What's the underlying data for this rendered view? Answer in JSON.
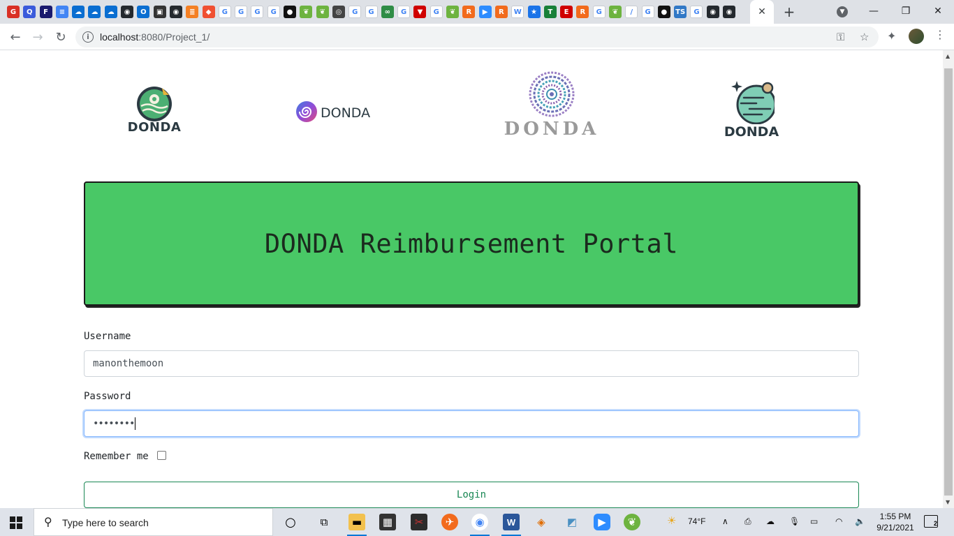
{
  "browser": {
    "tab_close_glyph": "✕",
    "new_tab_glyph": "+",
    "url_host": "localhost",
    "url_path": ":8080/Project_1/",
    "nav": {
      "back": "←",
      "forward": "→",
      "reload": "↻"
    },
    "window": {
      "minimize": "—",
      "restore": "❐",
      "close": "✕"
    },
    "tab_icons": [
      {
        "glyph": "G",
        "color": "#d93025"
      },
      {
        "glyph": "Q",
        "color": "#3b5bdb"
      },
      {
        "glyph": "F",
        "color": "#1a1a6e"
      },
      {
        "glyph": "≡",
        "color": "#4285f4"
      },
      {
        "glyph": "☁",
        "color": "#0a6ed1"
      },
      {
        "glyph": "☁",
        "color": "#0a6ed1"
      },
      {
        "glyph": "☁",
        "color": "#0a6ed1"
      },
      {
        "glyph": "◉",
        "color": "#24292e"
      },
      {
        "glyph": "O",
        "color": "#0a6ed1"
      },
      {
        "glyph": "▣",
        "color": "#333333"
      },
      {
        "glyph": "◉",
        "color": "#24292e"
      },
      {
        "glyph": "≣",
        "color": "#f48024"
      },
      {
        "glyph": "◆",
        "color": "#f05032"
      },
      {
        "glyph": "G",
        "color": "#ffffff"
      },
      {
        "glyph": "G",
        "color": "#ffffff"
      },
      {
        "glyph": "G",
        "color": "#ffffff"
      },
      {
        "glyph": "G",
        "color": "#ffffff"
      },
      {
        "glyph": "●",
        "color": "#111111"
      },
      {
        "glyph": "❦",
        "color": "#6db33f"
      },
      {
        "glyph": "❦",
        "color": "#6db33f"
      },
      {
        "glyph": "◎",
        "color": "#444444"
      },
      {
        "glyph": "G",
        "color": "#ffffff"
      },
      {
        "glyph": "G",
        "color": "#ffffff"
      },
      {
        "glyph": "∞",
        "color": "#2f8d46"
      },
      {
        "glyph": "G",
        "color": "#ffffff"
      },
      {
        "glyph": "▼",
        "color": "#d00000"
      },
      {
        "glyph": "G",
        "color": "#ffffff"
      },
      {
        "glyph": "❦",
        "color": "#6db33f"
      },
      {
        "glyph": "R",
        "color": "#f26b1d"
      },
      {
        "glyph": "▶",
        "color": "#2d8cff"
      },
      {
        "glyph": "R",
        "color": "#f26b1d"
      },
      {
        "glyph": "W",
        "color": "#ffffff"
      },
      {
        "glyph": "★",
        "color": "#1a73e8"
      },
      {
        "glyph": "T",
        "color": "#188038"
      },
      {
        "glyph": "E",
        "color": "#d00000"
      },
      {
        "glyph": "R",
        "color": "#f26b1d"
      },
      {
        "glyph": "G",
        "color": "#ffffff"
      },
      {
        "glyph": "❦",
        "color": "#6db33f"
      },
      {
        "glyph": "/",
        "color": "#ffffff"
      },
      {
        "glyph": "G",
        "color": "#ffffff"
      },
      {
        "glyph": "●",
        "color": "#111111"
      },
      {
        "glyph": "TS",
        "color": "#3178c6"
      },
      {
        "glyph": "G",
        "color": "#ffffff"
      },
      {
        "glyph": "◉",
        "color": "#24292e"
      },
      {
        "glyph": "◉",
        "color": "#24292e"
      }
    ]
  },
  "logos": [
    {
      "text": "DONDA"
    },
    {
      "text": "DONDA"
    },
    {
      "text": "DONDA"
    },
    {
      "text": "DONDA"
    }
  ],
  "banner": {
    "title": "DONDA Reimbursement Portal"
  },
  "form": {
    "username_label": "Username",
    "username_value": "manonthemoon",
    "password_label": "Password",
    "password_value": "••••••••",
    "remember_label": "Remember me",
    "login_label": "Login"
  },
  "taskbar": {
    "search_placeholder": "Type here to search",
    "weather": "74°F",
    "time": "1:55 PM",
    "date": "9/21/2021",
    "notification_count": "2",
    "colors": {
      "accent": "#0078d7"
    }
  },
  "colors": {
    "banner": "#49c866",
    "login": "#198754",
    "focus": "#86b7fe"
  }
}
